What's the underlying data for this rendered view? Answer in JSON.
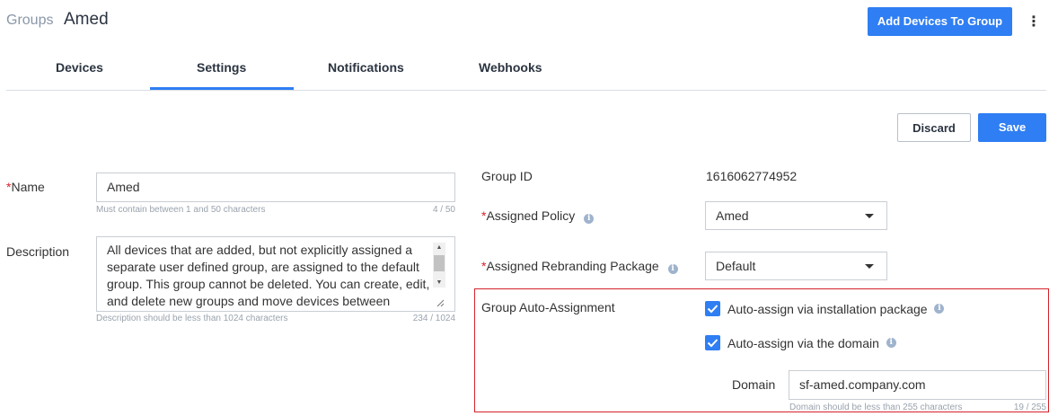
{
  "header": {
    "breadcrumb": "Groups",
    "title": "Amed",
    "add_devices_label": "Add Devices To Group",
    "more_glyph": "⋮"
  },
  "tabs": [
    {
      "label": "Devices",
      "active": false
    },
    {
      "label": "Settings",
      "active": true
    },
    {
      "label": "Notifications",
      "active": false
    },
    {
      "label": "Webhooks",
      "active": false
    }
  ],
  "actions": {
    "discard_label": "Discard",
    "save_label": "Save"
  },
  "form": {
    "name": {
      "required_mark": "*",
      "label": "Name",
      "value": "Amed",
      "hint": "Must contain between 1 and 50 characters",
      "counter": "4 / 50"
    },
    "description": {
      "label": "Description",
      "value": "All devices that are added, but not explicitly assigned a separate user defined group, are assigned to the default group. This group cannot be deleted. You can create, edit, and delete new groups and move devices between",
      "hint": "Description should be less than 1024 characters",
      "counter": "234 / 1024"
    },
    "group_id": {
      "label": "Group ID",
      "value": "1616062774952"
    },
    "assigned_policy": {
      "required_mark": "*",
      "label": "Assigned Policy",
      "value": "Amed"
    },
    "rebranding_package": {
      "required_mark": "*",
      "label": "Assigned Rebranding Package",
      "value": "Default"
    },
    "auto_assignment": {
      "label": "Group Auto-Assignment",
      "option_package": {
        "label": "Auto-assign via installation package",
        "checked": true
      },
      "option_domain": {
        "label": "Auto-assign via the domain",
        "checked": true
      },
      "domain_label": "Domain",
      "domain_value": "sf-amed.company.com",
      "domain_hint": "Domain should be less than 255 characters",
      "domain_counter": "19 / 255"
    }
  },
  "colors": {
    "accent": "#2f7ef3",
    "required": "#d4232b",
    "highlight_border": "#d4232b"
  }
}
